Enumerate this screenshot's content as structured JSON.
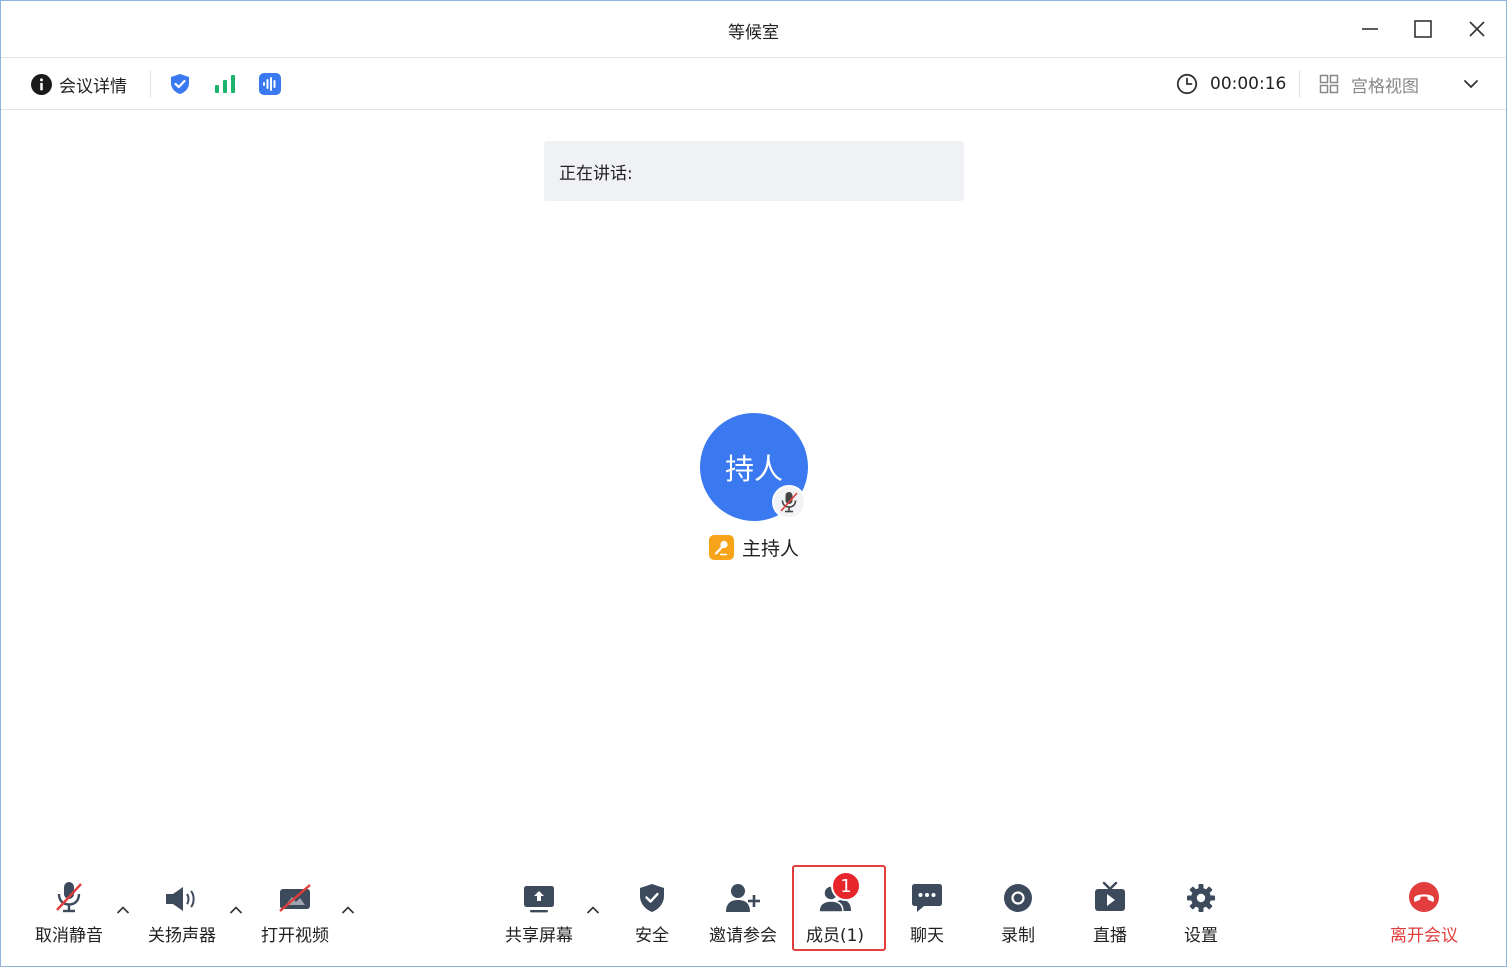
{
  "window": {
    "title": "等候室"
  },
  "toolbar": {
    "meeting_details_label": "会议详情",
    "timer": "00:00:16",
    "view_label": "宫格视图"
  },
  "main": {
    "speaking_label": "正在讲话:",
    "avatar_text": "持人",
    "host_name": "主持人"
  },
  "bottombar": {
    "unmute_label": "取消静音",
    "speaker_label": "关扬声器",
    "video_label": "打开视频",
    "share_label": "共享屏幕",
    "security_label": "安全",
    "invite_label": "邀请参会",
    "members_label": "成员(1)",
    "members_badge": "1",
    "chat_label": "聊天",
    "record_label": "录制",
    "live_label": "直播",
    "settings_label": "设置",
    "leave_label": "离开会议"
  },
  "colors": {
    "accent_blue": "#3a79f0",
    "signal_green": "#1db36b",
    "leave_red": "#e23d3d",
    "host_tag_orange": "#f8a41b"
  }
}
